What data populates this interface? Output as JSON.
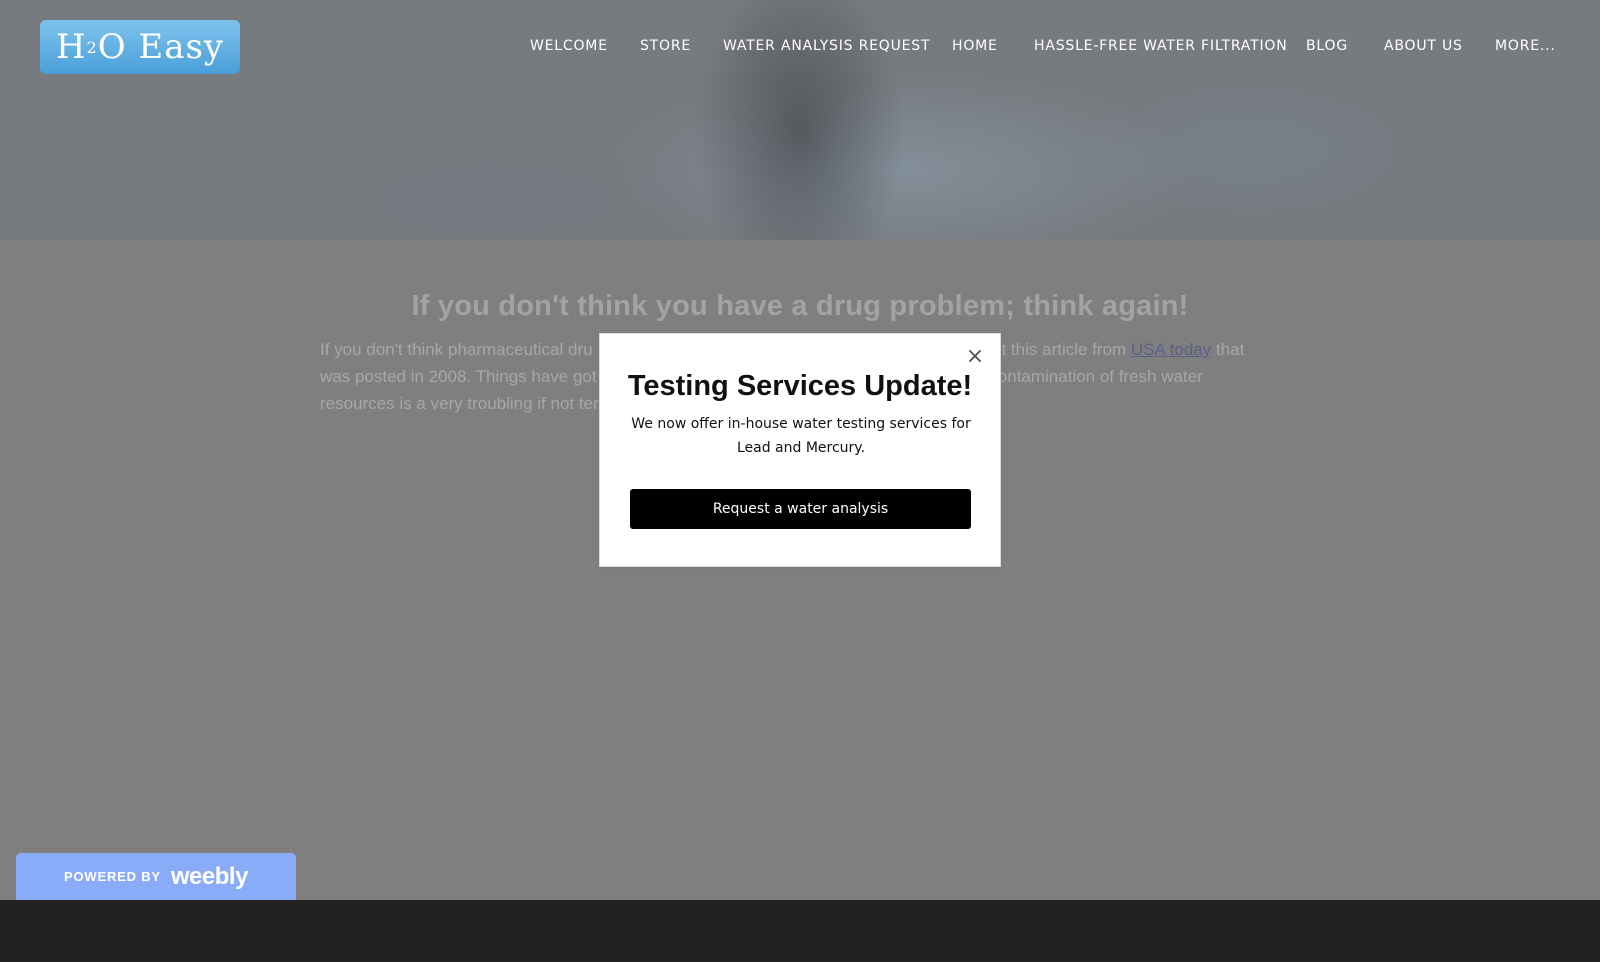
{
  "header": {
    "logo_text_h": "H",
    "logo_text_sub": "2",
    "logo_text_rest": "O Easy"
  },
  "nav": {
    "items": [
      {
        "label": "WELCOME"
      },
      {
        "label": "STORE"
      },
      {
        "label": "WATER ANALYSIS REQUEST"
      },
      {
        "label": "HOME"
      },
      {
        "label": "HASSLE-FREE WATER FILTRATION"
      },
      {
        "label": "BLOG"
      },
      {
        "label": "ABOUT US"
      },
      {
        "label": "MORE..."
      }
    ]
  },
  "post": {
    "title": "If you don't think you have a drug problem; think again!",
    "body_part1": "If you don't think pharmaceutical dru",
    "body_part2": "out this article from ",
    "link_text": "USA today",
    "body_part3": " that",
    "body_line2_a": "was posted in 2008. Things have got",
    "body_line2_b": "tal contamination of fresh water",
    "body_line3": "resources is a very troubling if not ter"
  },
  "popup": {
    "close_label": "×",
    "title": "Testing Services Update!",
    "text": "We now offer in-house water testing services for Lead and Mercury.",
    "button_label": "Request a water analysis"
  },
  "footer": {
    "powered_by": "POWERED BY",
    "weebly": "weebly"
  },
  "colors": {
    "logo_blue": "#4a9fd8",
    "badge_blue": "#8aabf8",
    "link": "#5c5f8c"
  }
}
